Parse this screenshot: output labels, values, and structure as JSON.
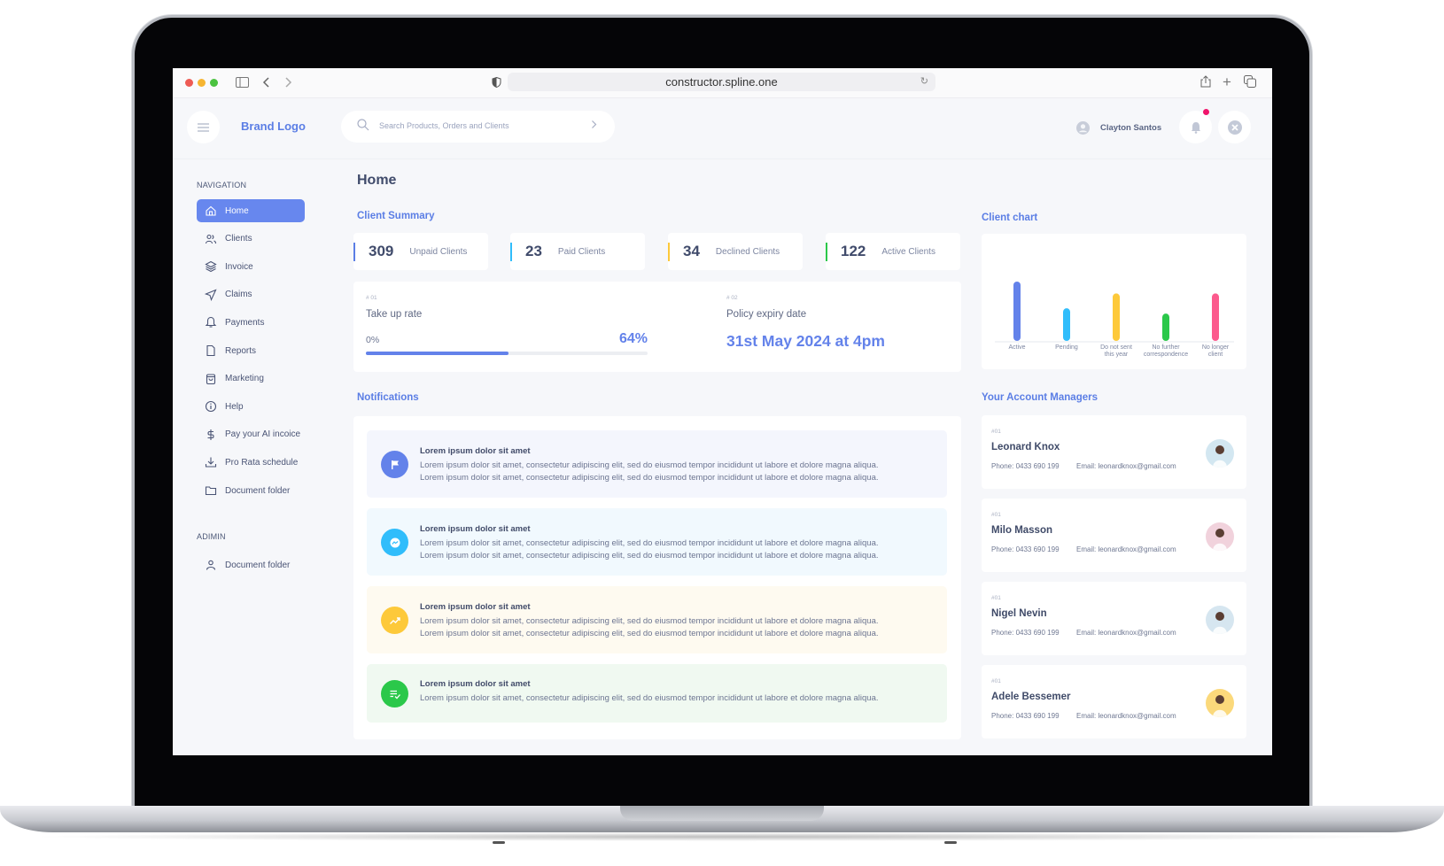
{
  "browser": {
    "url": "constructor.spline.one"
  },
  "header": {
    "brand": "Brand Logo",
    "search_placeholder": "Search Products, Orders and Clients",
    "user_name": "Clayton Santos",
    "notification_badge_color": "#f0146b"
  },
  "sidebar": {
    "navigation_label": "NAVIGATION",
    "items": [
      {
        "label": "Home",
        "icon": "home-icon",
        "active": true
      },
      {
        "label": "Clients",
        "icon": "users-icon"
      },
      {
        "label": "Invoice",
        "icon": "layers-icon"
      },
      {
        "label": "Claims",
        "icon": "send-icon"
      },
      {
        "label": "Payments",
        "icon": "bell-icon"
      },
      {
        "label": "Reports",
        "icon": "file-icon"
      },
      {
        "label": "Marketing",
        "icon": "shopping-bag-icon"
      },
      {
        "label": "Help",
        "icon": "info-icon"
      },
      {
        "label": "Pay your AI incoice",
        "icon": "dollar-icon"
      },
      {
        "label": "Pro Rata schedule",
        "icon": "download-icon"
      },
      {
        "label": "Document folder",
        "icon": "folder-icon"
      }
    ],
    "admin_label": "ADIMIN",
    "admin_items": [
      {
        "label": "Document folder",
        "icon": "user-icon"
      }
    ]
  },
  "main": {
    "title": "Home",
    "client_summary_title": "Client Summary",
    "stats": [
      {
        "value": "309",
        "label": "Unpaid Clients",
        "color": "#5b7ee5"
      },
      {
        "value": "23",
        "label": "Paid Clients",
        "color": "#30bdfb"
      },
      {
        "value": "34",
        "label": "Declined Clients",
        "color": "#fdc93a"
      },
      {
        "value": "122",
        "label": "Active Clients",
        "color": "#2bc84a"
      }
    ],
    "kpis": {
      "take_up": {
        "index": "# 01",
        "label": "Take up rate",
        "min_label": "0%",
        "value_label": "64%",
        "progress_fraction": 0.505
      },
      "policy": {
        "index": "# 02",
        "label": "Policy expiry date",
        "value": "31st May 2024 at 4pm"
      }
    },
    "notifications_title": "Notifications",
    "notifications": [
      {
        "icon": "flag-icon",
        "color": "#6382ea",
        "bg": "#f4f6fd",
        "title": "Lorem ipsum dolor sit amet",
        "lines": [
          "Lorem ipsum dolor sit amet, consectetur adipiscing elit, sed do eiusmod tempor incididunt ut labore et dolore magna aliqua.",
          "Lorem ipsum dolor sit amet, consectetur adipiscing elit, sed do eiusmod tempor incididunt ut labore et dolore magna aliqua."
        ]
      },
      {
        "icon": "messenger-icon",
        "color": "#30bdfb",
        "bg": "#f1f9fe",
        "title": "Lorem ipsum dolor sit amet",
        "lines": [
          "Lorem ipsum dolor sit amet, consectetur adipiscing elit, sed do eiusmod tempor incididunt ut labore et dolore magna aliqua.",
          "Lorem ipsum dolor sit amet, consectetur adipiscing elit, sed do eiusmod tempor incididunt ut labore et dolore magna aliqua."
        ]
      },
      {
        "icon": "trending-up-icon",
        "color": "#fdc93a",
        "bg": "#fefaf0",
        "title": "Lorem ipsum dolor sit amet",
        "lines": [
          "Lorem ipsum dolor sit amet, consectetur adipiscing elit, sed do eiusmod tempor incididunt ut labore et dolore magna aliqua.",
          "Lorem ipsum dolor sit amet, consectetur adipiscing elit, sed do eiusmod tempor incididunt ut labore et dolore magna aliqua."
        ]
      },
      {
        "icon": "list-check-icon",
        "color": "#2bc84a",
        "bg": "#f0f9f1",
        "title": "Lorem ipsum dolor sit amet",
        "lines": [
          "Lorem ipsum dolor sit amet, consectetur adipiscing elit, sed do eiusmod tempor incididunt ut labore et dolore magna aliqua."
        ]
      }
    ]
  },
  "right": {
    "chart_title": "Client chart",
    "managers_title": "Your Account Managers",
    "managers": [
      {
        "index": "#01",
        "name": "Leonard Knox",
        "phone": "Phone: 0433 690 199",
        "email": "Email: leonardknox@gmail.com",
        "avatar_bg": "#d3e7f1"
      },
      {
        "index": "#01",
        "name": "Milo Masson",
        "phone": "Phone: 0433 690 199",
        "email": "Email: leonardknox@gmail.com",
        "avatar_bg": "#f1d2dc"
      },
      {
        "index": "#01",
        "name": "Nigel Nevin",
        "phone": "Phone: 0433 690 199",
        "email": "Email: leonardknox@gmail.com",
        "avatar_bg": "#d6e6f0"
      },
      {
        "index": "#01",
        "name": "Adele Bessemer",
        "phone": "Phone: 0433 690 199",
        "email": "Email: leonardknox@gmail.com",
        "avatar_bg": "#fbd97b"
      }
    ]
  },
  "chart_data": {
    "type": "bar",
    "title": "Client chart",
    "categories": [
      "Active",
      "Pending",
      "Do not sent this year",
      "No further correspondence",
      "No longer client"
    ],
    "category_lines": [
      [
        "Active"
      ],
      [
        "Pending"
      ],
      [
        "Do not sent",
        "this year"
      ],
      [
        "No further",
        "correspondence"
      ],
      [
        "No longer",
        "client"
      ]
    ],
    "values": [
      100,
      55,
      80,
      46,
      80
    ],
    "colors": [
      "#6382ea",
      "#30bdfb",
      "#fdc93a",
      "#2bc84a",
      "#fc5a8d"
    ],
    "ylim": [
      0,
      100
    ],
    "xlabel": "",
    "ylabel": "",
    "grid": false,
    "legend": "none"
  }
}
